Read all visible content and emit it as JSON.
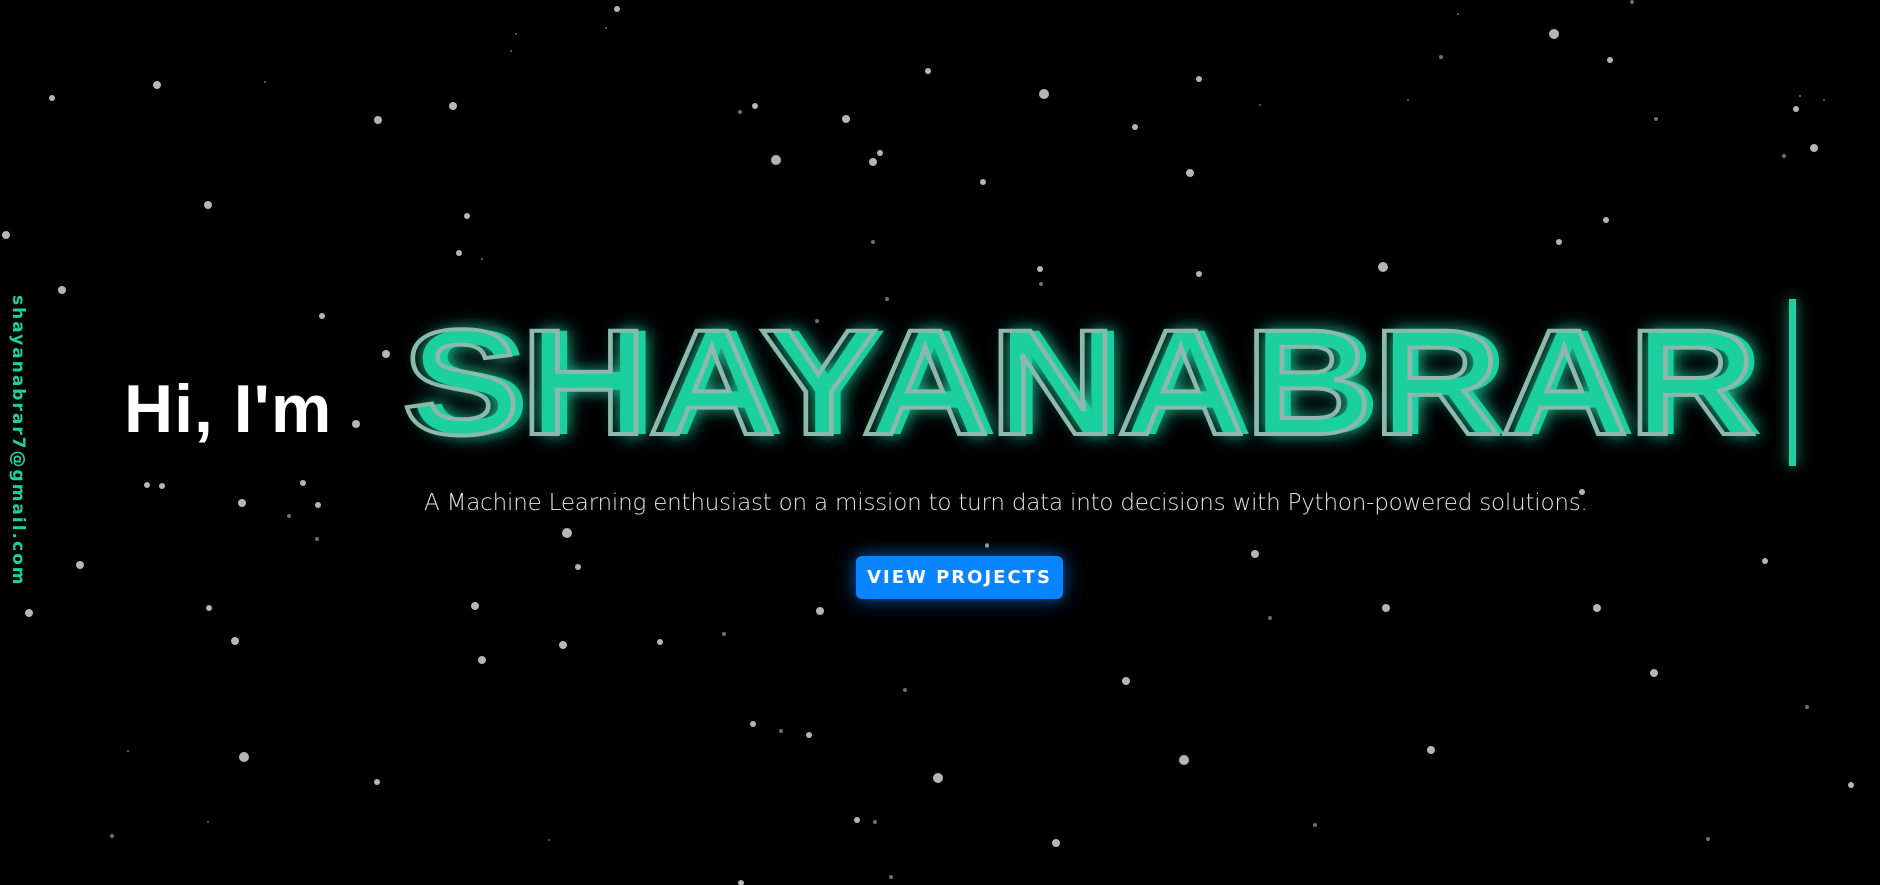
{
  "sidebar": {
    "email": "shayanabrar7@gmail.com"
  },
  "hero": {
    "greeting": "Hi, I'm",
    "name": "SHAYANABRAR",
    "tagline": "A Machine Learning enthusiast on a mission to turn data into decisions with Python-powered solutions.",
    "cta_label": "VIEW PROJECTS"
  },
  "colors": {
    "background": "#000000",
    "accent": "#1fcf9f",
    "name_outline": "#8fb8ad",
    "button": "#0a84ff",
    "star": "#c9c9c9"
  }
}
